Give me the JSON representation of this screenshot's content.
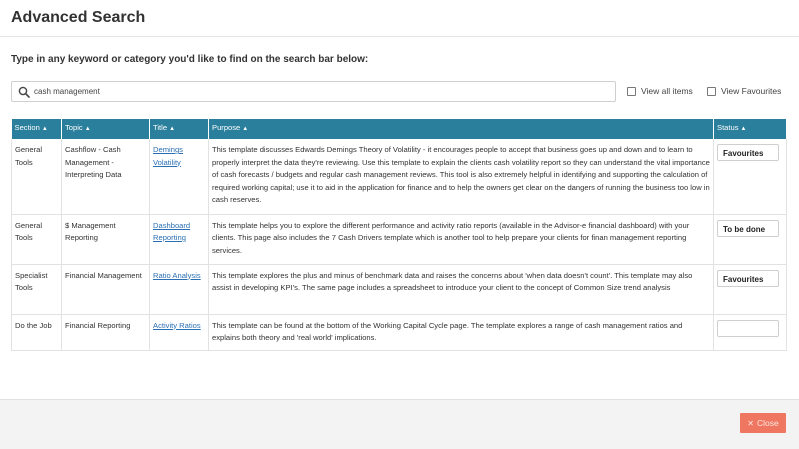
{
  "dialog": {
    "title": "Advanced Search",
    "instructions": "Type in any keyword or category you'd like to find on the search bar below:"
  },
  "search": {
    "value": "cash management",
    "icon": "search-icon"
  },
  "filters": {
    "view_all_label": "View all items",
    "view_favourites_label": "View Favourites"
  },
  "table": {
    "columns": [
      "Section",
      "Topic",
      "Title",
      "Purpose",
      "Status"
    ],
    "rows": [
      {
        "section": "General Tools",
        "topic": "Cashflow - Cash Management - Interpreting Data",
        "title": "Demings Volatility",
        "purpose": "This template discusses Edwards Demings Theory of Volatility - it encourages people to accept that business goes up and down and to learn to properly interpret the data they're reviewing. Use this template to explain the clients cash volatility report so they can understand the vital importance of cash forecasts / budgets and regular cash management reviews. This tool is also extremely helpful in identifying and supporting the calculation of required working capital; use it to aid in the application for finance and to help the owners get clear on the dangers of running the business too low in cash reserves.",
        "status": "Favourites"
      },
      {
        "section": "General Tools",
        "topic": "$ Management Reporting",
        "title": "Dashboard Reporting",
        "purpose": "This template helps you to explore the different performance and activity ratio reports (available in the Advisor-e financial dashboard) with your clients. This page also includes the 7 Cash Drivers template which is another tool to help prepare your clients for finan management reporting services.",
        "status": "To be done"
      },
      {
        "section": "Specialist Tools",
        "topic": "Financial Management",
        "title": "Ratio Analysis",
        "purpose": "This template explores the plus and minus of benchmark data and raises the concerns about 'when data doesn't count'. This template may also assist in developing KPI's. The same page includes a spreadsheet to introduce your client to the concept of Common Size trend analysis",
        "status": "Favourites"
      },
      {
        "section": "Do the Job",
        "topic": "Financial Reporting",
        "title": "Activity Ratios",
        "purpose": "This template can be found at the bottom of the Working Capital Cycle page. The template explores a range of cash management ratios and explains both theory and 'real world' implications.",
        "status": ""
      }
    ]
  },
  "footer": {
    "close_label": "Close",
    "close_color": "#ef7660"
  },
  "colors": {
    "header_bg": "#2a7f9c",
    "link": "#2a6fb3"
  }
}
